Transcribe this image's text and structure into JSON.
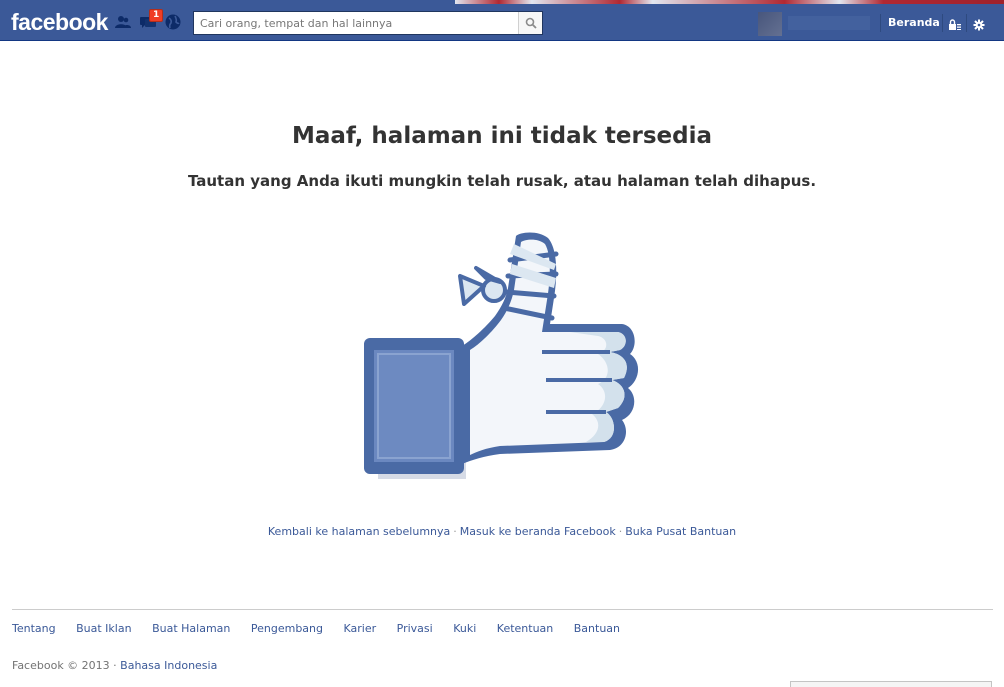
{
  "topbar": {
    "logo": "facebook",
    "notification_count": "1",
    "search": {
      "placeholder": "Cari orang, tempat dan hal lainnya",
      "value": ""
    },
    "home_label": "Beranda",
    "icons": [
      "friend-requests-icon",
      "messages-icon",
      "notifications-globe-icon",
      "search-icon",
      "privacy-shortcuts-icon",
      "settings-gear-icon"
    ]
  },
  "main": {
    "title": "Maaf, halaman ini tidak tersedia",
    "subtitle": "Tautan yang Anda ikuti mungkin telah rusak, atau halaman telah dihapus.",
    "illustration": "bandaged-thumbs-up",
    "links": [
      "Kembali ke halaman sebelumnya",
      "Masuk ke beranda Facebook",
      "Buka Pusat Bantuan"
    ],
    "separator": "·"
  },
  "footer": {
    "nav": [
      "Tentang",
      "Buat Iklan",
      "Buat Halaman",
      "Pengembang",
      "Karier",
      "Privasi",
      "Kuki",
      "Ketentuan",
      "Bantuan"
    ],
    "copyright": "Facebook © 2013 ·",
    "language": "Bahasa Indonesia"
  },
  "colors": {
    "brand_blue": "#3b5998",
    "text_dark": "#333333",
    "badge_red": "#f03d25"
  }
}
